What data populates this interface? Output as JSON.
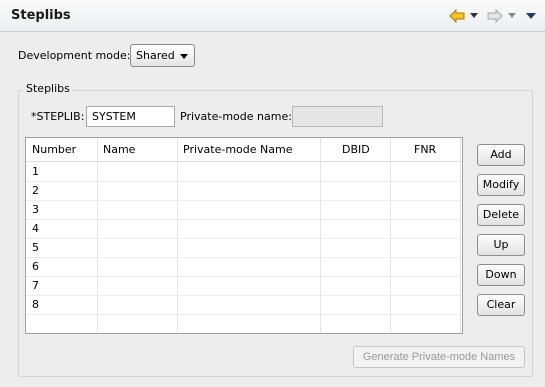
{
  "header": {
    "title": "Steplibs",
    "back_icon_color": "#e8a200",
    "forward_icon_color": "#b9b9b9"
  },
  "dev_mode": {
    "label": "Development mode:",
    "value": "Shared"
  },
  "steplibs_group": {
    "title": "Steplibs",
    "steplib_label": "*STEPLIB:",
    "steplib_value": "SYSTEM",
    "private_label": "Private-mode name:",
    "private_value": ""
  },
  "table": {
    "columns": [
      "Number",
      "Name",
      "Private-mode Name",
      "DBID",
      "FNR"
    ],
    "rows": [
      {
        "number": "1"
      },
      {
        "number": "2"
      },
      {
        "number": "3"
      },
      {
        "number": "4"
      },
      {
        "number": "5"
      },
      {
        "number": "6"
      },
      {
        "number": "7"
      },
      {
        "number": "8"
      }
    ]
  },
  "buttons": {
    "add": "Add",
    "modify": "Modify",
    "delete": "Delete",
    "up": "Up",
    "down": "Down",
    "clear": "Clear",
    "generate": "Generate Private-mode Names"
  }
}
